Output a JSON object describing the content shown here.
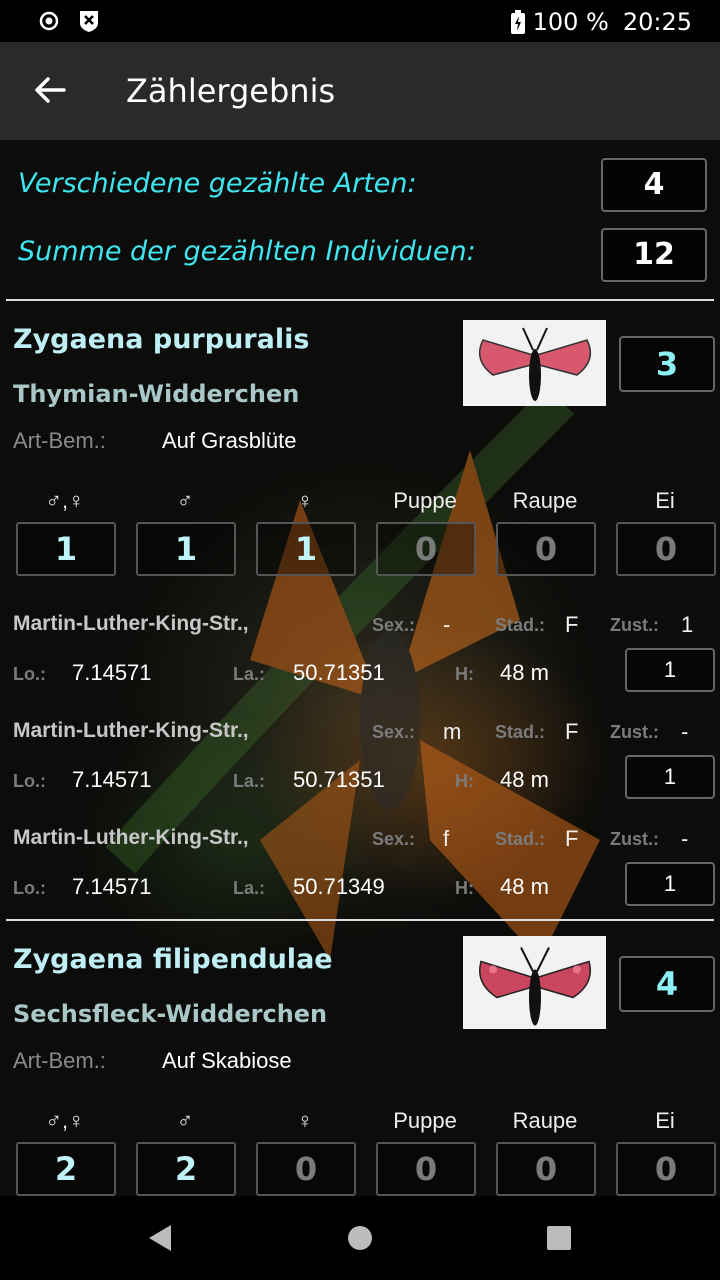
{
  "status_bar": {
    "battery": "100 %",
    "time": "20:25"
  },
  "app_bar": {
    "title": "Zählergebnis"
  },
  "summary": {
    "species_label": "Verschiedene gezählte Arten:",
    "species_count": "4",
    "individuals_label": "Summe der gezählten Individuen:",
    "individuals_count": "12"
  },
  "labels": {
    "art_bem": "Art-Bem.:",
    "sex": "Sex.:",
    "stad": "Stad.:",
    "zust": "Zust.:",
    "lo": "Lo.:",
    "la": "La.:",
    "h": "H:"
  },
  "stage_headers": [
    "♂,♀",
    "♂",
    "♀",
    "Puppe",
    "Raupe",
    "Ei"
  ],
  "species": [
    {
      "scientific": "Zygaena purpuralis",
      "common": "Thymian-Widderchen",
      "count": "3",
      "remark": "Auf Grasblüte",
      "stages": [
        "1",
        "1",
        "1",
        "0",
        "0",
        "0"
      ],
      "observations": [
        {
          "location": "Martin-Luther-King-Str.,",
          "sex": "-",
          "stad": "F",
          "zust": "1",
          "lo": "7.14571",
          "la": "50.71351",
          "h": "48 m",
          "count": "1"
        },
        {
          "location": "Martin-Luther-King-Str.,",
          "sex": "m",
          "stad": "F",
          "zust": "-",
          "lo": "7.14571",
          "la": "50.71351",
          "h": "48 m",
          "count": "1"
        },
        {
          "location": "Martin-Luther-King-Str.,",
          "sex": "f",
          "stad": "F",
          "zust": "-",
          "lo": "7.14571",
          "la": "50.71349",
          "h": "48 m",
          "count": "1"
        }
      ]
    },
    {
      "scientific": "Zygaena filipendulae",
      "common": "Sechsfleck-Widderchen",
      "count": "4",
      "remark": "Auf Skabiose",
      "stages": [
        "2",
        "2",
        "0",
        "0",
        "0",
        "0"
      ]
    }
  ],
  "colors": {
    "accent": "#3fe6f0",
    "count": "#8ef0f7",
    "background": "#000000",
    "appbar": "#2a2a2a"
  },
  "icons": [
    "radio-icon",
    "shield-icon",
    "battery-charging-icon",
    "back-arrow-icon",
    "nav-back-icon",
    "nav-home-icon",
    "nav-recents-icon"
  ]
}
